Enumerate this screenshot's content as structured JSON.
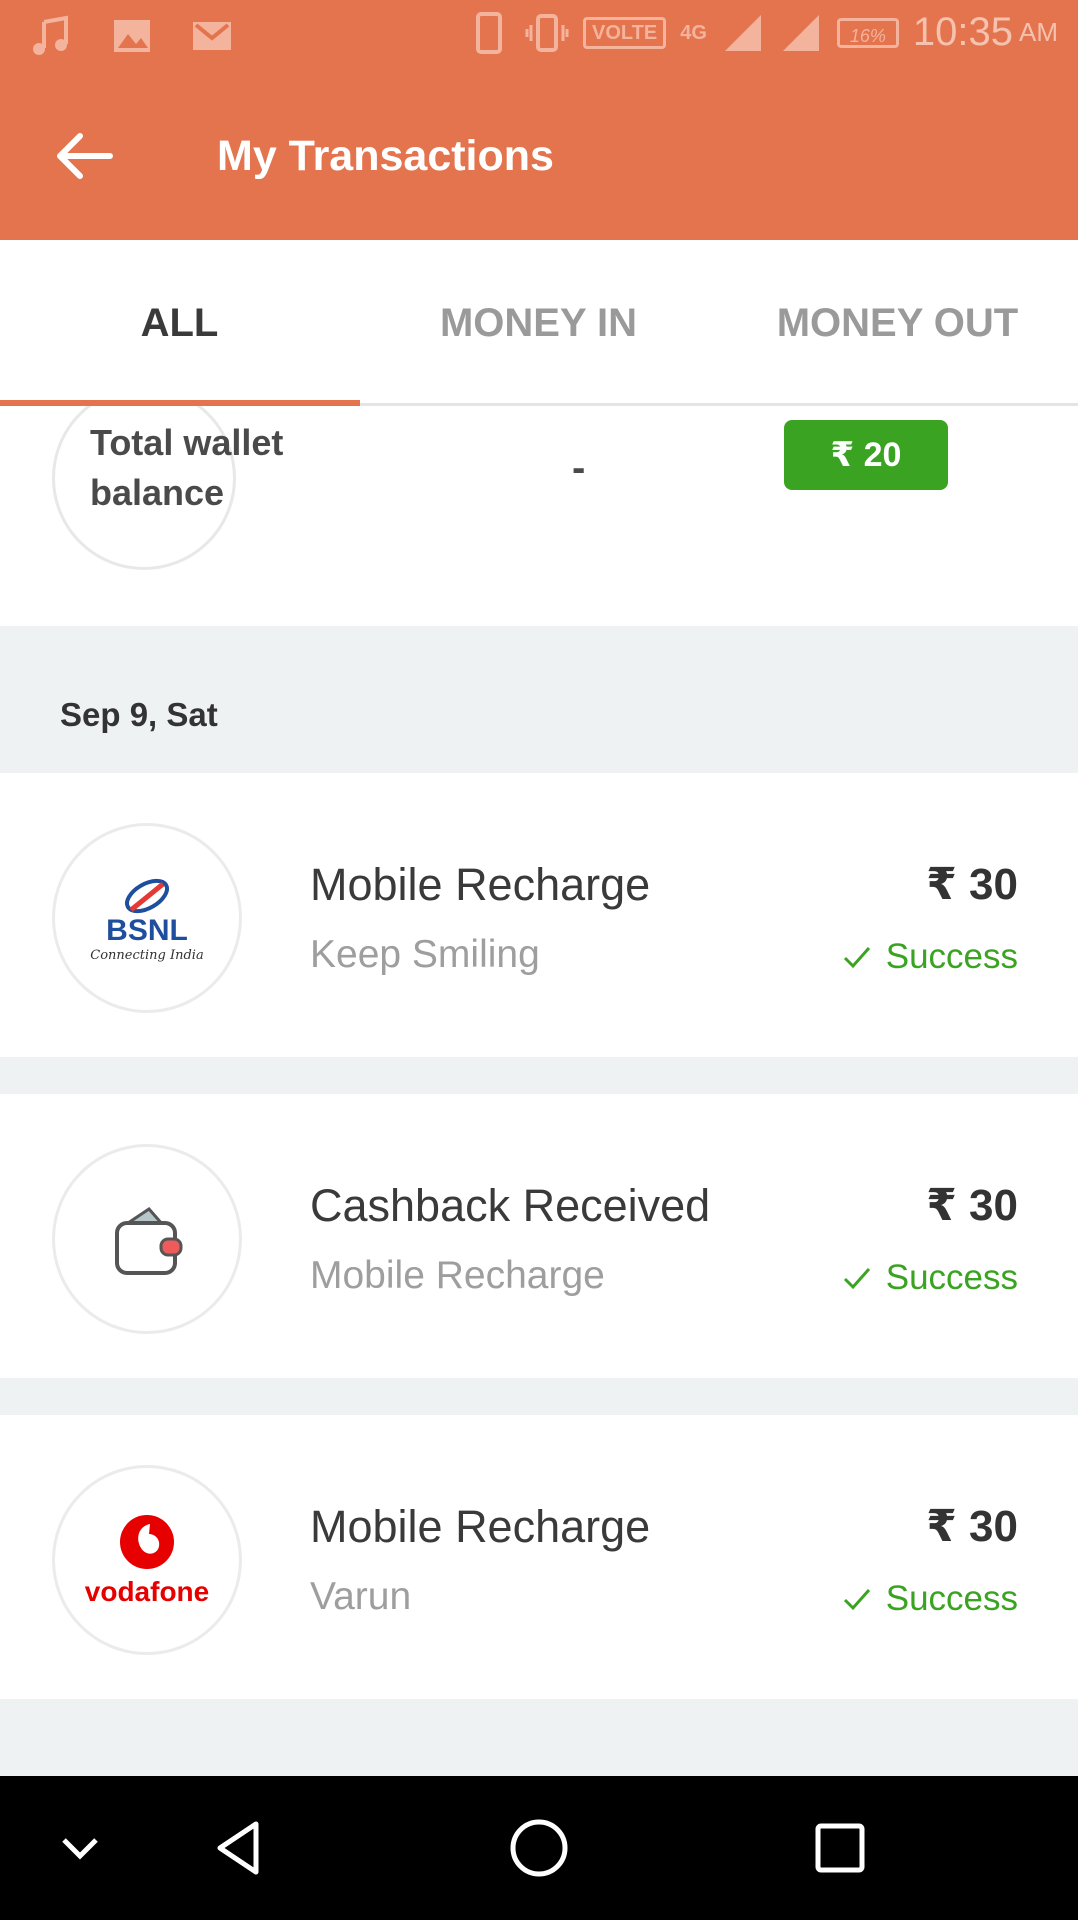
{
  "status_bar": {
    "network_badge": "VOLTE",
    "network_type": "4G",
    "battery": "16%",
    "time": "10:35",
    "ampm": "AM",
    "icons": [
      "music-icon",
      "image-icon",
      "gmail-icon",
      "phone-icon",
      "vibrate-icon",
      "signal-icon",
      "signal-icon",
      "battery-icon"
    ]
  },
  "app_bar": {
    "title": "My Transactions",
    "back_icon": "arrow-left-icon"
  },
  "tabs": [
    {
      "label": "ALL",
      "active": true
    },
    {
      "label": "MONEY IN",
      "active": false
    },
    {
      "label": "MONEY OUT",
      "active": false
    }
  ],
  "wallet": {
    "label": "Total wallet balance",
    "dash": "-",
    "amount": "₹ 20"
  },
  "date_header": "Sep 9, Sat",
  "transactions": [
    {
      "logo": "BSNL",
      "logo_sub": "Connecting India",
      "title": "Mobile Recharge",
      "subtitle": "Keep Smiling",
      "amount": "₹ 30",
      "status": "Success"
    },
    {
      "logo": "wallet-icon",
      "title": "Cashback Received",
      "subtitle": "Mobile Recharge",
      "amount": "₹ 30",
      "status": "Success"
    },
    {
      "logo": "vodafone",
      "title": "Mobile Recharge",
      "subtitle": "Varun",
      "amount": "₹ 30",
      "status": "Success"
    }
  ],
  "colors": {
    "primary": "#e4744e",
    "success": "#3aa422",
    "background": "#eff2f3"
  },
  "nav_bar": {
    "icons": [
      "chevron-down-icon",
      "back-triangle-icon",
      "home-circle-icon",
      "recents-square-icon"
    ]
  }
}
